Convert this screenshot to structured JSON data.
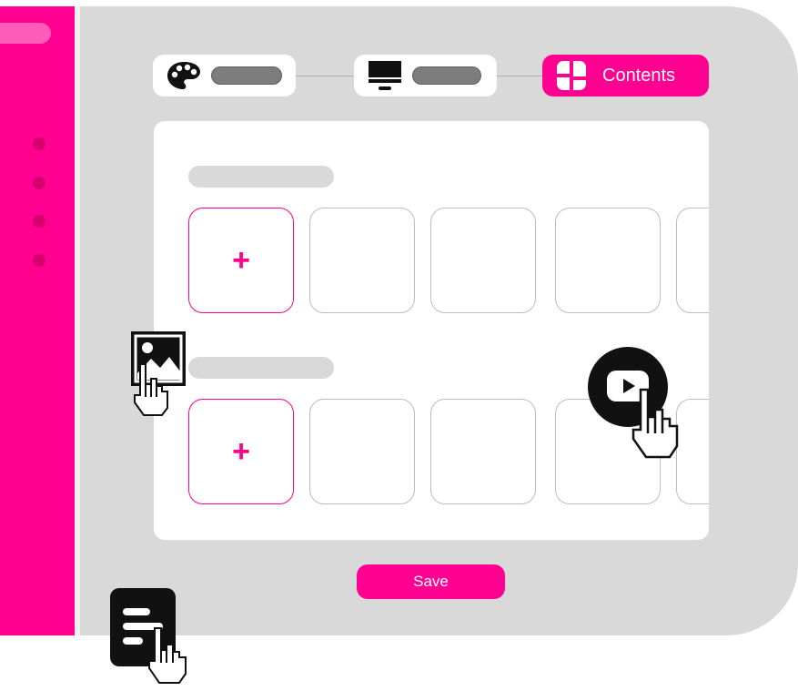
{
  "steps": [
    {
      "icon": "palette-icon",
      "label": "",
      "state": "inactive"
    },
    {
      "icon": "monitor-icon",
      "label": "",
      "state": "inactive"
    },
    {
      "icon": "grid-icon",
      "label": "Contents",
      "state": "active"
    }
  ],
  "rows": [
    {
      "title": "",
      "add_symbol": "+",
      "tiles": 5
    },
    {
      "title": "",
      "add_symbol": "+",
      "tiles": 5
    }
  ],
  "save_label": "Save",
  "floating_icons": [
    "image-icon",
    "youtube-play-icon",
    "document-icon",
    "hand-pointer-icon"
  ],
  "colors": {
    "accent": "#ff0090",
    "background": "#d9d9d9",
    "panel": "#ffffff"
  }
}
